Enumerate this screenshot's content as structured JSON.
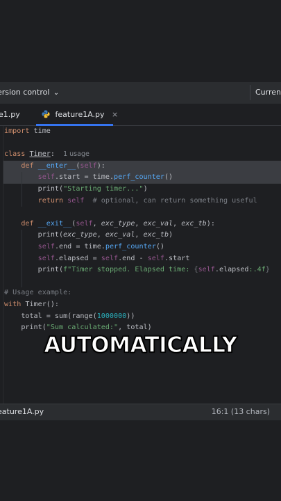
{
  "toolbar": {
    "vcs_label": "ersion control",
    "vcs_chevron": "⌄",
    "right_label": "Curren"
  },
  "tabs": [
    {
      "label": "e1.py",
      "active": false
    },
    {
      "label": "feature1A.py",
      "active": true,
      "close": "×"
    }
  ],
  "code": {
    "l1": {
      "kw": "import",
      "rest": " time"
    },
    "l3": {
      "kw": "class",
      "name": "Timer",
      "colon": ":",
      "hint": "1 usage"
    },
    "l4": {
      "kw": "def",
      "name": "__enter__",
      "p1": "(",
      "self": "self",
      "p2": "):"
    },
    "l5": {
      "self": "self",
      "a": ".start = time.",
      "fn": "perf_counter",
      "b": "()"
    },
    "l6": {
      "a": "print(",
      "str": "\"Starting timer...\"",
      "b": ")"
    },
    "l7": {
      "kw": "return",
      "self": "self",
      "comment": "# optional, can return something useful"
    },
    "l9": {
      "kw": "def",
      "name": "__exit__",
      "p1": "(",
      "self": "self",
      "c1": ", ",
      "exc_type": "exc_type",
      "c2": ", ",
      "exc_val": "exc_val",
      "c3": ", ",
      "exc_tb": "exc_tb",
      "p2": "):"
    },
    "l10": {
      "a": "print(",
      "exc_type": "exc_type",
      "c1": ", ",
      "exc_val": "exc_val",
      "c2": ", ",
      "exc_tb": "exc_tb",
      "b": ")"
    },
    "l11": {
      "self": "self",
      "a": ".end = time.",
      "fn": "perf_counter",
      "b": "()"
    },
    "l12": {
      "self1": "self",
      "a": ".elapsed = ",
      "self2": "self",
      "b": ".end - ",
      "self3": "self",
      "c": ".start"
    },
    "l13": {
      "a": "print(",
      "f": "f\"Timer stopped. Elapsed time: ",
      "br1": "{",
      "self": "self",
      "attr": ".elapsed",
      "fmt": ":.4f",
      "br2": "}"
    },
    "l15": {
      "comment": "# Usage example:"
    },
    "l16": {
      "kw": "with",
      "rest": " Timer():"
    },
    "l17": {
      "a": "total = sum(range(",
      "num": "1000000",
      "b": "))"
    },
    "l18": {
      "a": "print(",
      "str": "\"Sum calculated:\"",
      "b": ", total)"
    }
  },
  "caption": "AUTOMATICALLY",
  "status": {
    "file": "eature1A.py",
    "position": "16:1 (13 chars)"
  },
  "colors": {
    "background": "#1e1f22",
    "keyword": "#cf8e6d",
    "function": "#56a8f5",
    "self": "#94558d",
    "string": "#6aab73",
    "number": "#2aacb8",
    "comment": "#7a7e85",
    "accent": "#3574f0"
  }
}
